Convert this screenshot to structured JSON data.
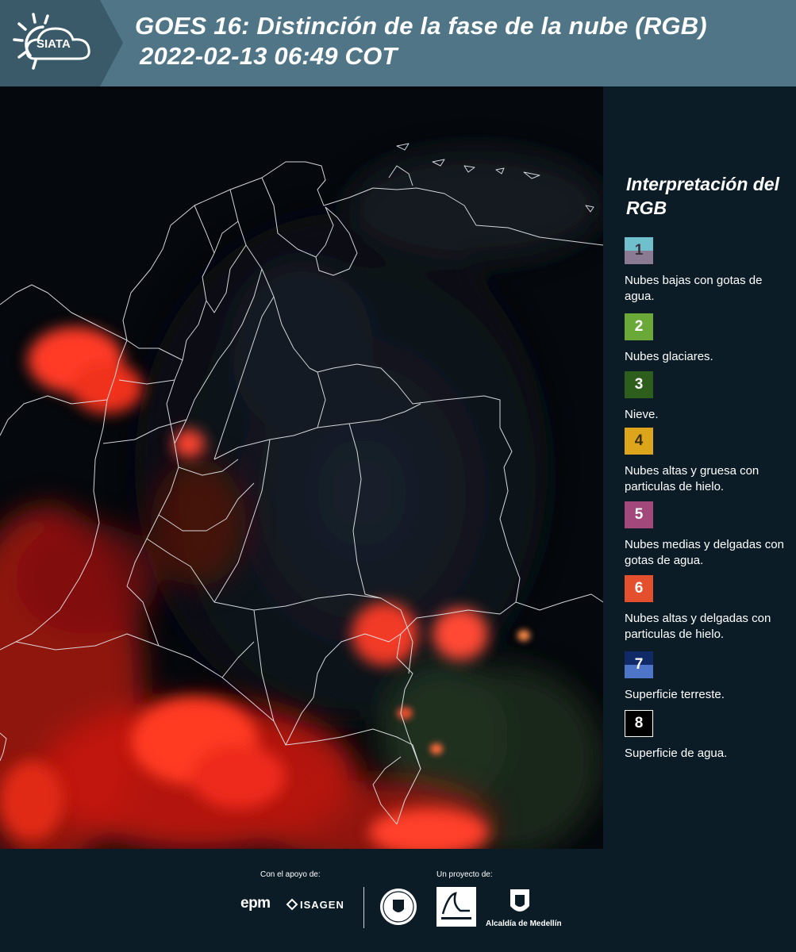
{
  "header": {
    "logo_text": "SIATA",
    "title_line1": "GOES 16: Distinción de la fase de la nube (RGB)",
    "title_line2": "2022-02-13 06:49 COT",
    "accent_color": "#4f7586"
  },
  "legend": {
    "title": "Interpretación del RGB",
    "items": [
      {
        "number": "1",
        "label": "Nubes bajas con gotas de agua.",
        "color_top": "#6fbfcc",
        "color_bottom": "#8a7a92"
      },
      {
        "number": "2",
        "label": "Nubes glaciares.",
        "color_top": "#6aa837",
        "color_bottom": "#6aa837"
      },
      {
        "number": "3",
        "label": "Nieve.",
        "color_top": "#2e5e1c",
        "color_bottom": "#2e5e1c"
      },
      {
        "number": "4",
        "label": "Nubes altas y gruesa con particulas de hielo.",
        "color_top": "#dca51c",
        "color_bottom": "#dca51c"
      },
      {
        "number": "5",
        "label": "Nubes medias y delgadas con gotas de agua.",
        "color_top": "#a2487a",
        "color_bottom": "#a2487a"
      },
      {
        "number": "6",
        "label": "Nubes altas y delgadas con particulas de hielo.",
        "color_top": "#e4502d",
        "color_bottom": "#e4502d"
      },
      {
        "number": "7",
        "label": "Superficie terreste.",
        "color_top": "#0f2a66",
        "color_bottom": "#4d76c8"
      },
      {
        "number": "8",
        "label": "Superficie de agua.",
        "color_top": "#000000",
        "color_bottom": "#000000"
      }
    ]
  },
  "footer": {
    "support_label": "Con el apoyo de:",
    "project_label": "Un proyecto de:",
    "epm": "epm",
    "isagen": "ISAGEN",
    "alcaldia": "Alcaldía de Medellín"
  }
}
